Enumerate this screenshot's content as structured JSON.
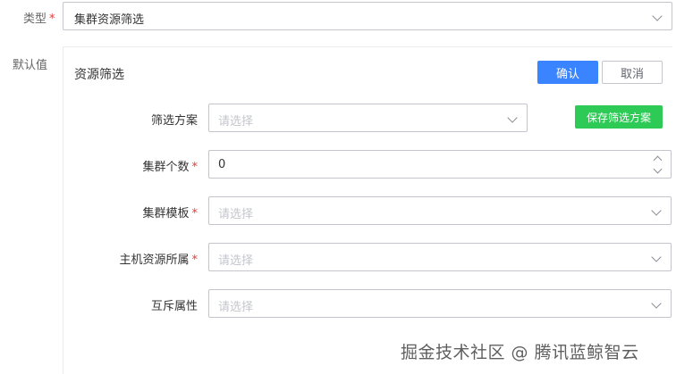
{
  "type_field": {
    "label": "类型",
    "required_mark": "*",
    "value": "集群资源筛选"
  },
  "default_field": {
    "label": "默认值"
  },
  "panel": {
    "title": "资源筛选",
    "confirm_label": "确认",
    "cancel_label": "取消",
    "save_scheme_label": "保存筛选方案",
    "fields": [
      {
        "label": "筛选方案",
        "required": false,
        "placeholder": "请选择"
      },
      {
        "label": "集群个数",
        "required": true,
        "value": "0"
      },
      {
        "label": "集群模板",
        "required": true,
        "placeholder": "请选择"
      },
      {
        "label": "主机资源所属",
        "required": true,
        "placeholder": "请选择"
      },
      {
        "label": "互斥属性",
        "required": false,
        "placeholder": "请选择"
      }
    ]
  },
  "required_mark": "*",
  "watermark": "掘金技术社区 @ 腾讯蓝鲸智云",
  "colors": {
    "primary": "#3a84ff",
    "success": "#2dcb56",
    "required": "#ea3636",
    "border": "#c4c6cc"
  }
}
